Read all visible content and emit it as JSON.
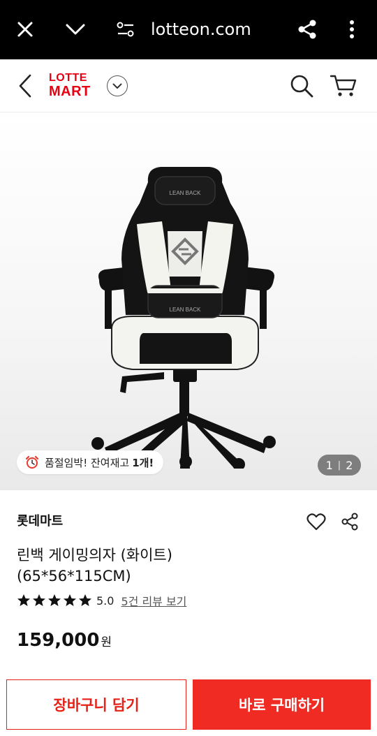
{
  "browser": {
    "url": "lotteon.com",
    "icons": [
      "close-icon",
      "chevron-down-icon",
      "site-settings-icon",
      "share-icon",
      "more-vertical-icon"
    ]
  },
  "header": {
    "logo_line1": "LOTTE",
    "logo_line2": "MART",
    "icons": [
      "back-icon",
      "chevron-down-icon",
      "search-icon",
      "cart-icon"
    ],
    "brand_color": "#e60012"
  },
  "product": {
    "image_label": "LEAN BACK",
    "stock_text": "품절임박! 잔여재고",
    "stock_count": "1개!",
    "page_current": "1",
    "page_separator": "|",
    "page_total": "2",
    "seller": "롯데마트",
    "title_line1": "린백 게이밍의자 (화이트)",
    "title_line2": "(65*56*115CM)",
    "rating_value": 5.0,
    "score_text": "5.0",
    "review_text": "5건 리뷰 보기",
    "price": "159,000",
    "price_unit": "원"
  },
  "actions": {
    "cart_label": "장바구니 담기",
    "buy_label": "바로 구매하기",
    "accent_color": "#ef2b23"
  }
}
